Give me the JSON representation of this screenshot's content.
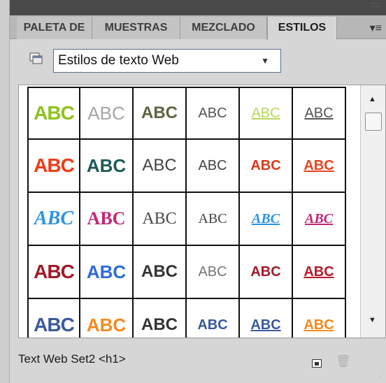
{
  "panel": {
    "tabs": [
      {
        "label": "PALETA DE",
        "active": false
      },
      {
        "label": "MUESTRAS",
        "active": false
      },
      {
        "label": "MEZCLADO",
        "active": false
      },
      {
        "label": "ESTILOS",
        "active": true
      }
    ],
    "menu_icon": "panel-menu-icon"
  },
  "style_set": {
    "value": "Estilos de texto Web",
    "icon": "style-set-icon"
  },
  "swatches": [
    [
      {
        "text": "ABC",
        "color": "#8dc21f",
        "font": "sans-condensed",
        "bold": true,
        "underline": false,
        "italic": false
      },
      {
        "text": "ABC",
        "color": "#a6a6a6",
        "font": "sans",
        "bold": false,
        "underline": false,
        "italic": false
      },
      {
        "text": "ABC",
        "color": "#5f6440",
        "font": "sans",
        "bold": true,
        "underline": false,
        "italic": false
      },
      {
        "text": "ABC",
        "color": "#555555",
        "font": "sans",
        "bold": false,
        "underline": false,
        "italic": false
      },
      {
        "text": "ABC",
        "color": "#b9d65e",
        "font": "sans",
        "bold": false,
        "underline": true,
        "italic": false
      },
      {
        "text": "ABC",
        "color": "#555555",
        "font": "sans",
        "bold": false,
        "underline": true,
        "italic": false
      }
    ],
    [
      {
        "text": "ABC",
        "color": "#f03b17",
        "font": "sans-condensed",
        "bold": true,
        "underline": false,
        "italic": false
      },
      {
        "text": "ABC",
        "color": "#1d5a57",
        "font": "sans",
        "bold": true,
        "underline": false,
        "italic": false
      },
      {
        "text": "ABC",
        "color": "#444444",
        "font": "sans",
        "bold": false,
        "underline": false,
        "italic": false
      },
      {
        "text": "ABC",
        "color": "#444444",
        "font": "sans",
        "bold": false,
        "underline": false,
        "italic": false
      },
      {
        "text": "ABC",
        "color": "#d93a1a",
        "font": "sans",
        "bold": true,
        "underline": false,
        "italic": false
      },
      {
        "text": "ABC",
        "color": "#e8431c",
        "font": "sans",
        "bold": true,
        "underline": true,
        "italic": false
      }
    ],
    [
      {
        "text": "ABC",
        "color": "#2c93e6",
        "font": "serif",
        "bold": true,
        "underline": false,
        "italic": true
      },
      {
        "text": "ABC",
        "color": "#c42677",
        "font": "serif",
        "bold": true,
        "underline": false,
        "italic": false
      },
      {
        "text": "ABC",
        "color": "#4a4a4a",
        "font": "serif",
        "bold": false,
        "underline": false,
        "italic": false
      },
      {
        "text": "ABC",
        "color": "#444444",
        "font": "serif",
        "bold": false,
        "underline": false,
        "italic": false
      },
      {
        "text": "ABC",
        "color": "#2c93e6",
        "font": "serif",
        "bold": true,
        "underline": true,
        "italic": true
      },
      {
        "text": "ABC",
        "color": "#c42677",
        "font": "serif",
        "bold": true,
        "underline": true,
        "italic": true
      }
    ],
    [
      {
        "text": "ABC",
        "color": "#a11a29",
        "font": "sans-condensed",
        "bold": true,
        "underline": false,
        "italic": false
      },
      {
        "text": "ABC",
        "color": "#2e6bd6",
        "font": "sans",
        "bold": true,
        "underline": false,
        "italic": false
      },
      {
        "text": "ABC",
        "color": "#333333",
        "font": "sans",
        "bold": true,
        "underline": false,
        "italic": false
      },
      {
        "text": "ABC",
        "color": "#777777",
        "font": "sans",
        "bold": false,
        "underline": false,
        "italic": false
      },
      {
        "text": "ABC",
        "color": "#a11a29",
        "font": "sans",
        "bold": true,
        "underline": false,
        "italic": false
      },
      {
        "text": "ABC",
        "color": "#b51c2c",
        "font": "sans",
        "bold": true,
        "underline": true,
        "italic": false
      }
    ],
    [
      {
        "text": "ABC",
        "color": "#3a5a9c",
        "font": "sans-condensed",
        "bold": true,
        "underline": false,
        "italic": false
      },
      {
        "text": "ABC",
        "color": "#f58a1f",
        "font": "sans",
        "bold": true,
        "underline": false,
        "italic": false
      },
      {
        "text": "ABC",
        "color": "#333333",
        "font": "sans",
        "bold": true,
        "underline": false,
        "italic": false
      },
      {
        "text": "ABC",
        "color": "#3a5a9c",
        "font": "sans",
        "bold": true,
        "underline": false,
        "italic": false
      },
      {
        "text": "ABC",
        "color": "#3a5a9c",
        "font": "sans",
        "bold": true,
        "underline": true,
        "italic": false
      },
      {
        "text": "ABC",
        "color": "#f58a1f",
        "font": "sans",
        "bold": true,
        "underline": true,
        "italic": false
      }
    ]
  ],
  "footer": {
    "selected_style": "Text Web Set2 <h1>"
  }
}
